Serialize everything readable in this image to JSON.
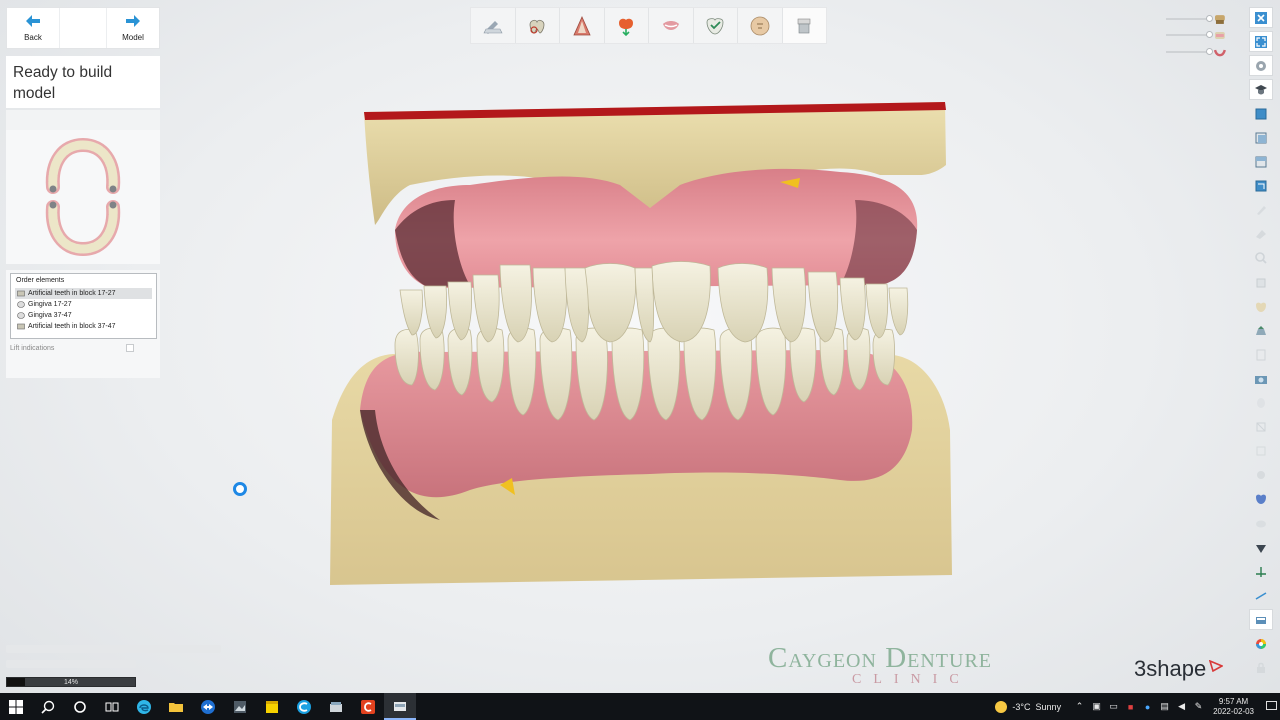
{
  "nav": {
    "back_label": "Back",
    "model_label": "Model"
  },
  "status": {
    "text": "Ready to build model"
  },
  "order": {
    "title": "Order elements",
    "items": [
      "Artificial teeth in block 17-27",
      "Gingiva 17-27",
      "Gingiva 37-47",
      "Artificial teeth in block 37-47"
    ],
    "lift_label": "Lift indications"
  },
  "top_tools": [
    "scan-edit-icon",
    "tooth-gear-icon",
    "gingiva-shape-icon",
    "tooth-color-icon",
    "smile-lips-icon",
    "tooth-shield-icon",
    "face-profile-icon",
    "model-base-icon"
  ],
  "right_tools": [
    "close-icon",
    "fullscreen-icon",
    "gear-icon",
    "graduation-cap-icon",
    "view-front-icon",
    "view-side-icon",
    "view-top-icon",
    "view-3d-icon",
    "brush-icon",
    "tool-faded-icon",
    "magnifier-icon",
    "cube-faded-icon",
    "tooth-faded-icon",
    "model-icon",
    "ruler-icon",
    "camera-icon",
    "face-icon",
    "tooth-cross-icon",
    "tooth-outline-icon",
    "gingiva-icon",
    "tooth-blue-icon",
    "cloud-icon",
    "triangle-icon",
    "axis-icon",
    "measure-icon",
    "teeth-box-icon",
    "color-wheel-icon",
    "lock-icon"
  ],
  "progress": {
    "value": 0.14,
    "label": "14%"
  },
  "branding": {
    "clinic": "Caygeon Denture",
    "clinic_sub": "CLINIC",
    "brand": "3shape"
  },
  "taskbar": {
    "weather_temp": "-3°C",
    "weather_cond": "Sunny",
    "time": "9:57 AM",
    "date": "2022-02-03",
    "apps": [
      "search-icon",
      "cortana-icon",
      "task-view-icon",
      "edge-icon",
      "file-explorer-icon",
      "teamviewer-icon",
      "photo-app-icon",
      "sticky-notes-icon",
      "c-app-icon",
      "3shape-model-icon",
      "c-red-app-icon",
      "dental-app-icon"
    ]
  },
  "colors": {
    "accent": "#1e88e5",
    "gingiva": "#e59aa0",
    "plaster": "#e2d3a3",
    "teeth": "#ebe6cf",
    "clinic_green": "#8fb49d",
    "clinic_pink": "#c99aa3"
  }
}
